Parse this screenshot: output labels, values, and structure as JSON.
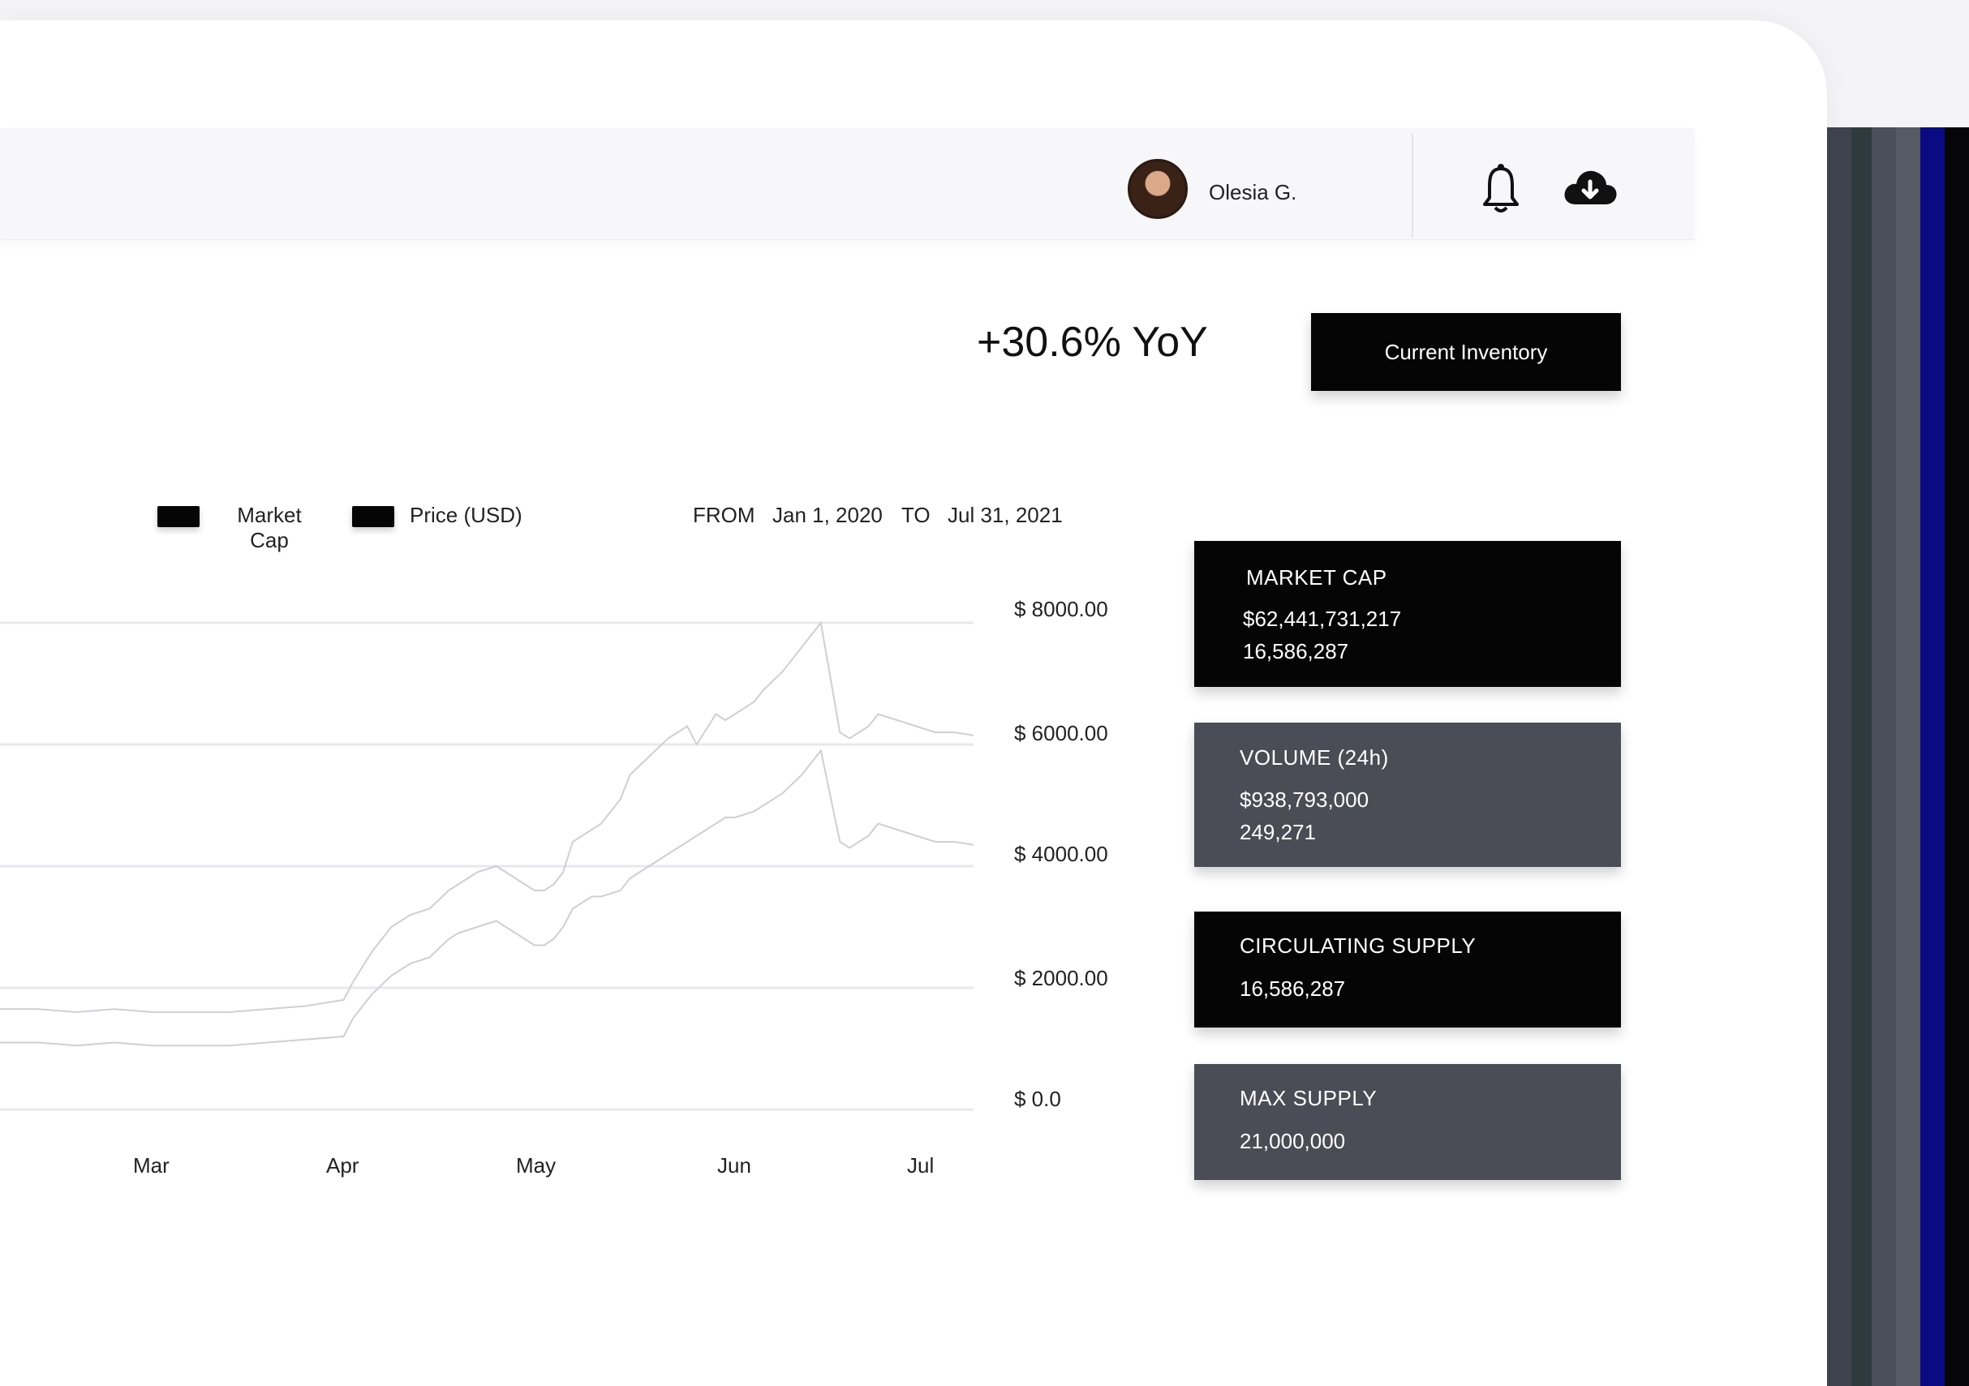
{
  "header": {
    "user_name": "Olesia G.",
    "icons": [
      "avatar",
      "bell-icon",
      "cloud-download-icon"
    ]
  },
  "summary": {
    "yoy": "+30.6% YoY",
    "inventory_button": "Current Inventory"
  },
  "legend": {
    "market_cap_line1": "Market",
    "market_cap_line2": "Cap",
    "price": "Price (USD)"
  },
  "range": {
    "from_label": "FROM",
    "from_value": "Jan 1, 2020",
    "to_label": "TO",
    "to_value": "Jul 31, 2021"
  },
  "stats": {
    "market_cap": {
      "title": "MARKET CAP",
      "value1": "$62,441,731,217",
      "value2": "16,586,287"
    },
    "volume": {
      "title": "VOLUME (24h)",
      "value1": "$938,793,000",
      "value2": "249,271"
    },
    "circulating": {
      "title": "CIRCULATING SUPPLY",
      "value1": "16,586,287"
    },
    "max_supply": {
      "title": "MAX SUPPLY",
      "value1": "21,000,000"
    }
  },
  "colors": {
    "dark": "#050505",
    "gray": "#4a4d56",
    "line": "#cfcfd4",
    "grid": "#e8e8ec"
  },
  "chart_data": {
    "type": "line",
    "y_tick_labels": [
      "$ 8000.00",
      "$ 6000.00",
      "$ 4000.00",
      "$ 2000.00",
      "$ 0.0"
    ],
    "y_ticks": [
      8000,
      6000,
      4000,
      2000,
      0
    ],
    "ylim": [
      0,
      8000
    ],
    "x_tick_labels": [
      "Mar",
      "Apr",
      "May",
      "Jun",
      "Jul"
    ],
    "x_ticks": [
      2.5,
      3.5,
      4.5,
      5.5,
      6.5
    ],
    "xlim": [
      1.7,
      6.8
    ],
    "grid": true,
    "series": [
      {
        "name": "Market Cap",
        "x": [
          1.7,
          1.9,
          2.1,
          2.3,
          2.5,
          2.7,
          2.9,
          3.1,
          3.3,
          3.5,
          3.55,
          3.65,
          3.75,
          3.85,
          3.95,
          4.05,
          4.1,
          4.2,
          4.3,
          4.4,
          4.5,
          4.55,
          4.6,
          4.65,
          4.7,
          4.8,
          4.85,
          4.95,
          5.0,
          5.1,
          5.2,
          5.3,
          5.35,
          5.45,
          5.5,
          5.55,
          5.6,
          5.65,
          5.7,
          5.8,
          5.9,
          6.0,
          6.1,
          6.15,
          6.2,
          6.25,
          6.3,
          6.4,
          6.5,
          6.6,
          6.7,
          6.8
        ],
        "y": [
          1650,
          1650,
          1600,
          1650,
          1600,
          1600,
          1600,
          1650,
          1700,
          1800,
          2100,
          2600,
          3000,
          3200,
          3300,
          3600,
          3700,
          3900,
          4000,
          3800,
          3600,
          3600,
          3700,
          3900,
          4400,
          4600,
          4700,
          5100,
          5500,
          5800,
          6100,
          6300,
          6000,
          6500,
          6400,
          6500,
          6600,
          6700,
          6900,
          7200,
          7600,
          8000,
          6200,
          6100,
          6200,
          6300,
          6500,
          6400,
          6300,
          6200,
          6200,
          6150
        ]
      },
      {
        "name": "Price (USD)",
        "x": [
          1.7,
          1.9,
          2.1,
          2.3,
          2.5,
          2.7,
          2.9,
          3.1,
          3.3,
          3.5,
          3.55,
          3.65,
          3.75,
          3.85,
          3.95,
          4.05,
          4.1,
          4.2,
          4.3,
          4.4,
          4.5,
          4.55,
          4.6,
          4.65,
          4.7,
          4.8,
          4.85,
          4.95,
          5.0,
          5.1,
          5.2,
          5.3,
          5.35,
          5.45,
          5.5,
          5.55,
          5.6,
          5.65,
          5.7,
          5.8,
          5.9,
          6.0,
          6.1,
          6.15,
          6.2,
          6.25,
          6.3,
          6.4,
          6.5,
          6.6,
          6.7,
          6.8
        ],
        "y": [
          1100,
          1100,
          1050,
          1100,
          1050,
          1050,
          1050,
          1100,
          1150,
          1200,
          1500,
          1900,
          2200,
          2400,
          2500,
          2800,
          2900,
          3000,
          3100,
          2900,
          2700,
          2700,
          2800,
          3000,
          3300,
          3500,
          3500,
          3600,
          3800,
          4000,
          4200,
          4400,
          4500,
          4700,
          4800,
          4800,
          4850,
          4900,
          5000,
          5200,
          5500,
          5900,
          4400,
          4300,
          4400,
          4500,
          4700,
          4600,
          4500,
          4400,
          4400,
          4350
        ]
      }
    ]
  }
}
